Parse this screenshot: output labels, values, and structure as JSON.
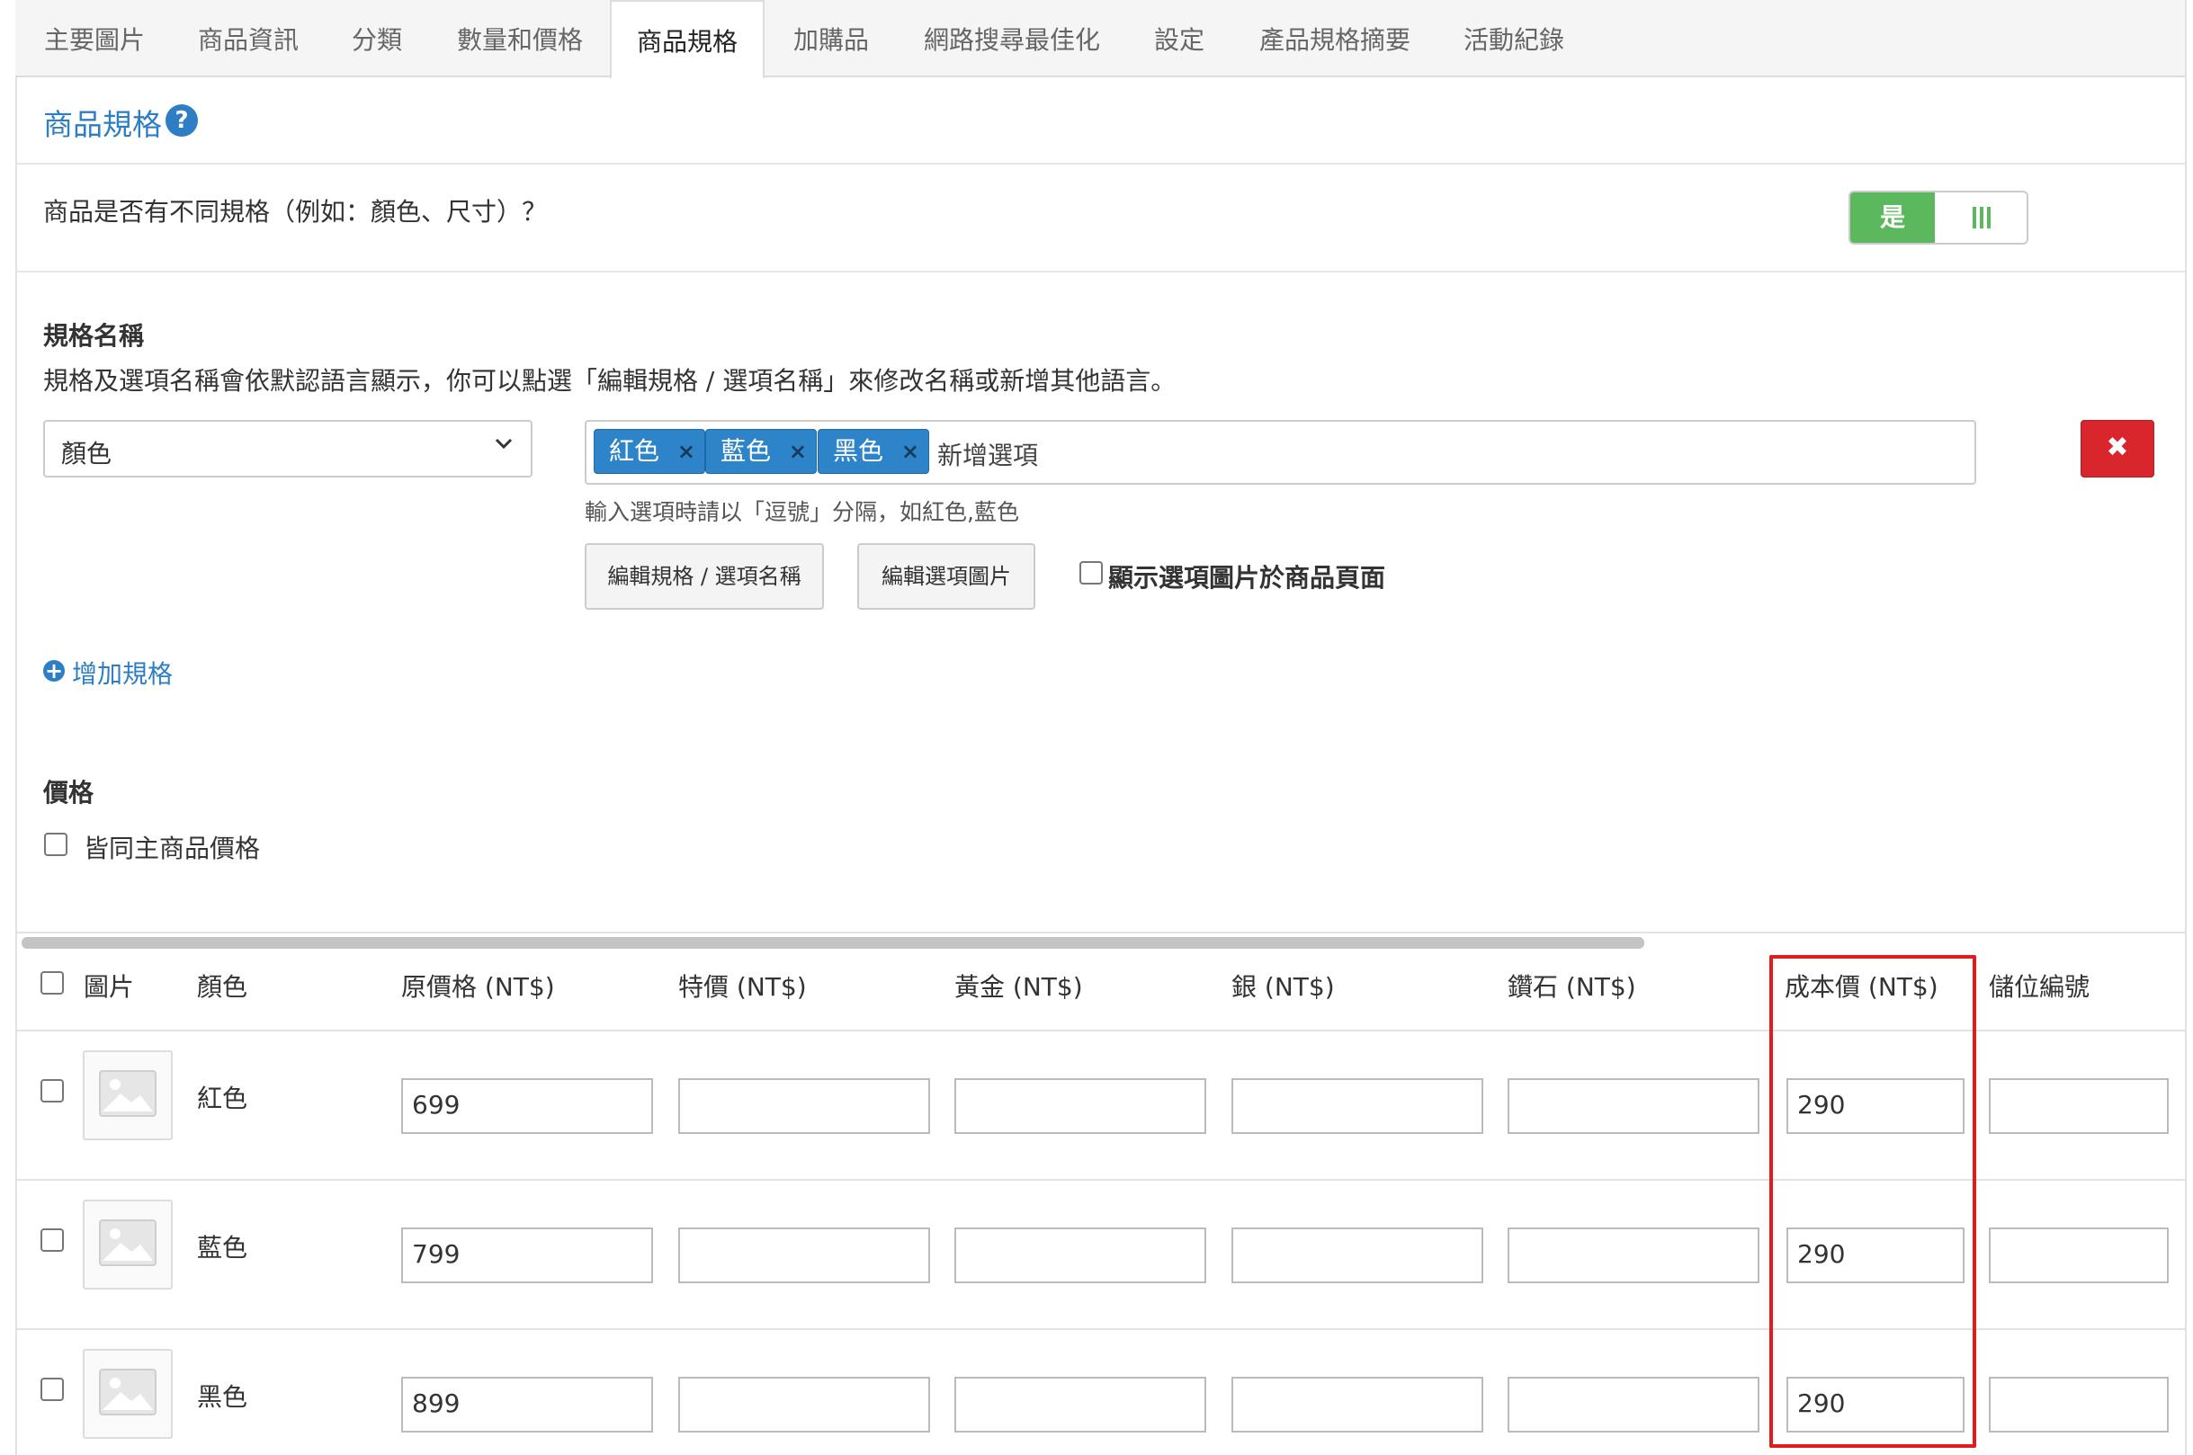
{
  "tabs": [
    {
      "label": "主要圖片",
      "active": false
    },
    {
      "label": "商品資訊",
      "active": false
    },
    {
      "label": "分類",
      "active": false
    },
    {
      "label": "數量和價格",
      "active": false
    },
    {
      "label": "商品規格",
      "active": true
    },
    {
      "label": "加購品",
      "active": false
    },
    {
      "label": "網路搜尋最佳化",
      "active": false
    },
    {
      "label": "設定",
      "active": false
    },
    {
      "label": "產品規格摘要",
      "active": false
    },
    {
      "label": "活動紀錄",
      "active": false
    }
  ],
  "section": {
    "title": "商品規格",
    "help_icon": "?"
  },
  "variants_question": {
    "label": "商品是否有不同規格（例如：顏色、尺寸）？",
    "toggle_on": "是",
    "toggle_state": "on"
  },
  "spec": {
    "heading": "規格名稱",
    "description": "規格及選項名稱會依默認語言顯示，你可以點選「編輯規格 / 選項名稱」來修改名稱或新增其他語言。",
    "selected_spec": "顏色",
    "options": [
      "紅色",
      "藍色",
      "黑色"
    ],
    "option_remove_icon": "×",
    "add_option_placeholder": "新增選項",
    "hint": "輸入選項時請以「逗號」分隔，如紅色,藍色",
    "edit_names_button": "編輯規格 / 選項名稱",
    "edit_images_button": "編輯選項圖片",
    "show_images_label": "顯示選項圖片於商品頁面",
    "delete_icon": "✖",
    "add_spec_link": "增加規格",
    "add_icon": "+"
  },
  "price": {
    "heading": "價格",
    "same_as_main_label": "皆同主商品價格"
  },
  "table": {
    "headers": [
      "圖片",
      "顏色",
      "原價格 (NT$)",
      "特價 (NT$)",
      "黃金 (NT$)",
      "銀 (NT$)",
      "鑽石 (NT$)",
      "成本價 (NT$)",
      "儲位編號"
    ],
    "rows": [
      {
        "color": "紅色",
        "original_price": "699",
        "sale_price": "",
        "gold": "",
        "silver": "",
        "diamond": "",
        "cost": "290",
        "location": ""
      },
      {
        "color": "藍色",
        "original_price": "799",
        "sale_price": "",
        "gold": "",
        "silver": "",
        "diamond": "",
        "cost": "290",
        "location": ""
      },
      {
        "color": "黑色",
        "original_price": "899",
        "sale_price": "",
        "gold": "",
        "silver": "",
        "diamond": "",
        "cost": "290",
        "location": ""
      }
    ]
  },
  "colors": {
    "accent": "#2d7ec4",
    "toggle_on": "#5cb85c",
    "danger": "#d9262c",
    "highlight": "#e21b1b"
  }
}
